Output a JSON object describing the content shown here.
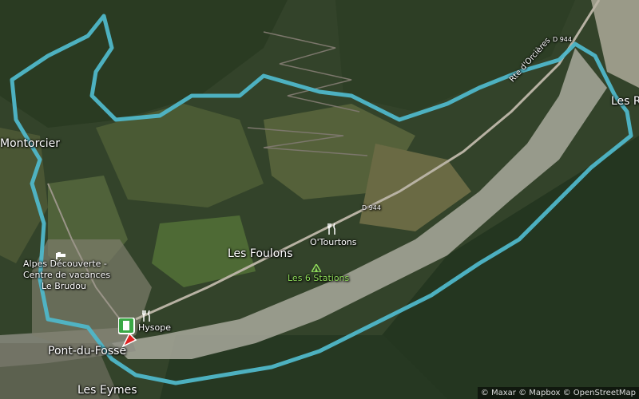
{
  "places": {
    "montorcier": "Montorcier",
    "les_r": "Les R",
    "les_foulons": "Les Foulons",
    "pont_du_fosse": "Pont-du-Fosse",
    "les_eymes": "Les Eymes"
  },
  "pois": {
    "alpes_line1": "Alpes Découverte -",
    "alpes_line2": "Centre de vacances",
    "alpes_line3": "Le Brudou",
    "hysope": "Hysope",
    "o_tourtons": "O'Tourtons",
    "les_6_stations": "Les 6 Stations"
  },
  "roads": {
    "rte_orcieres": "Rte d'Orcières",
    "d944_1": "D 944",
    "d944_2": "D 944"
  },
  "attribution": "© Maxar © Mapbox © OpenStreetMap",
  "colors": {
    "route": "#4fb7c9",
    "start_flag_green": "#3aa845",
    "end_marker_red": "#e02020"
  },
  "icons": {
    "restaurant": "fork-knife-icon",
    "start": "start-flag-icon",
    "end": "end-marker-icon",
    "lodging": "bed-icon",
    "campsite": "tent-icon"
  }
}
